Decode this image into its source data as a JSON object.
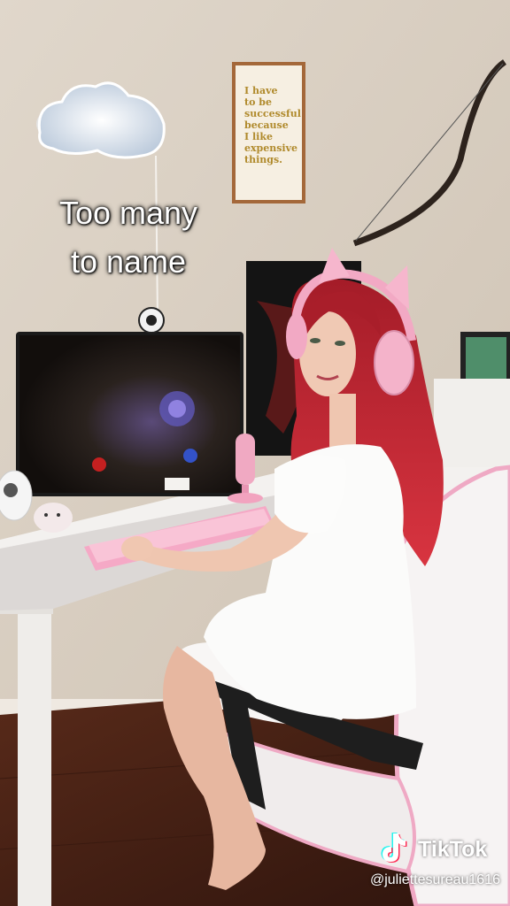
{
  "caption": {
    "line1": "Too many",
    "line2": "to name"
  },
  "poster": {
    "lines": [
      "I have",
      "to be",
      "successful",
      "because",
      "I like",
      "expensive",
      "things."
    ]
  },
  "watermark": {
    "brand": "TikTok",
    "handle": "@juliettesureau1616",
    "icon": "tiktok-logo-icon"
  },
  "colors": {
    "wall": "#d9cfc3",
    "floor": "#4a2418",
    "desk": "#f3f1ef",
    "accent_pink": "#f2b6cc",
    "hair": "#b8232e"
  }
}
